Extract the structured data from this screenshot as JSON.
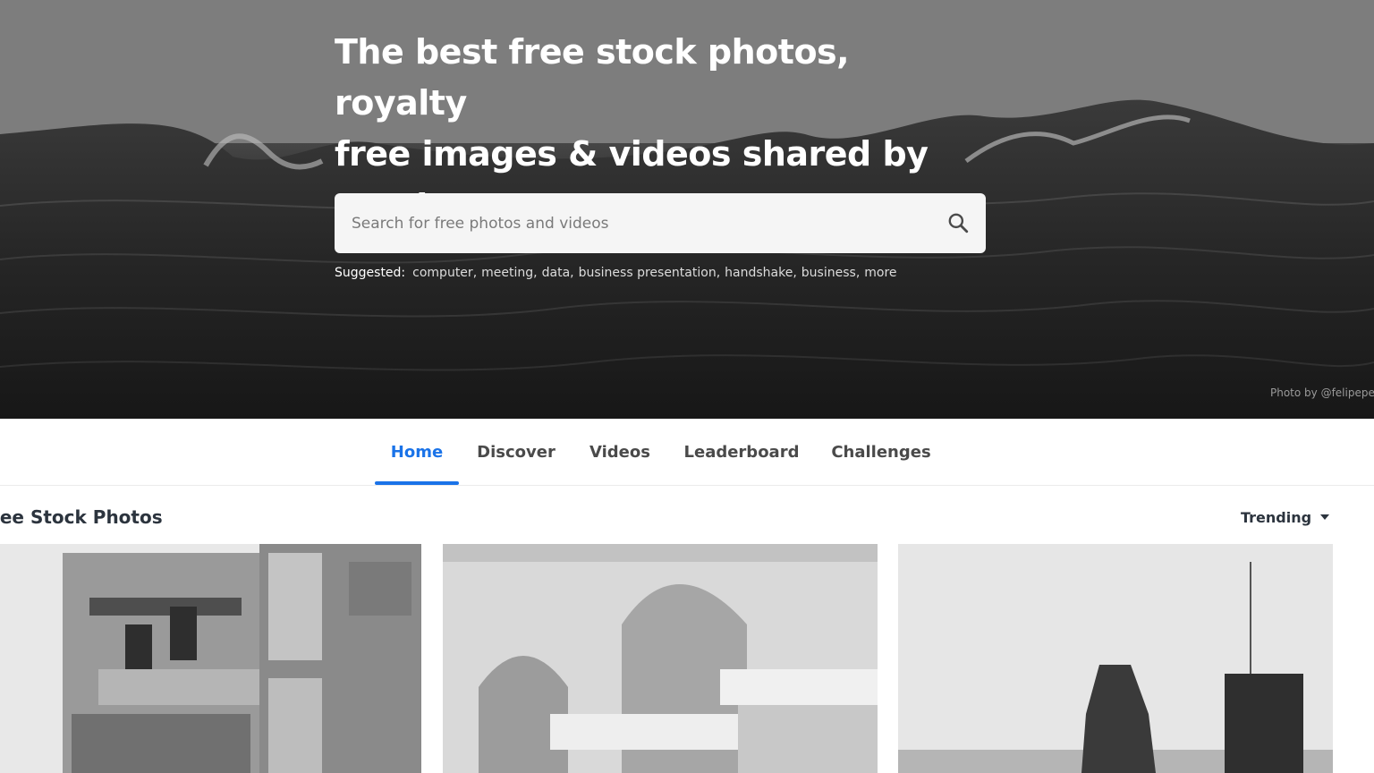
{
  "hero": {
    "title_line_1": "The best free stock photos, royalty",
    "title_line_2": "free images & videos shared by",
    "title_line_3": "creators.",
    "search_placeholder": "Search for free photos and videos",
    "search_icon": "search-icon",
    "suggested_label": "Suggested:",
    "suggestions": [
      "computer",
      "meeting",
      "data",
      "business presentation",
      "handshake",
      "business",
      "more"
    ],
    "photo_credit": "Photo by @felipepe"
  },
  "tabs": [
    {
      "label": "Home",
      "active": true
    },
    {
      "label": "Discover",
      "active": false
    },
    {
      "label": "Videos",
      "active": false
    },
    {
      "label": "Leaderboard",
      "active": false
    },
    {
      "label": "Challenges",
      "active": false
    }
  ],
  "section": {
    "title": "ree Stock Photos",
    "sort_label": "Trending",
    "sort_icon": "caret-down-icon"
  },
  "colors": {
    "accent": "#1a73e8",
    "text": "#2c343e"
  }
}
